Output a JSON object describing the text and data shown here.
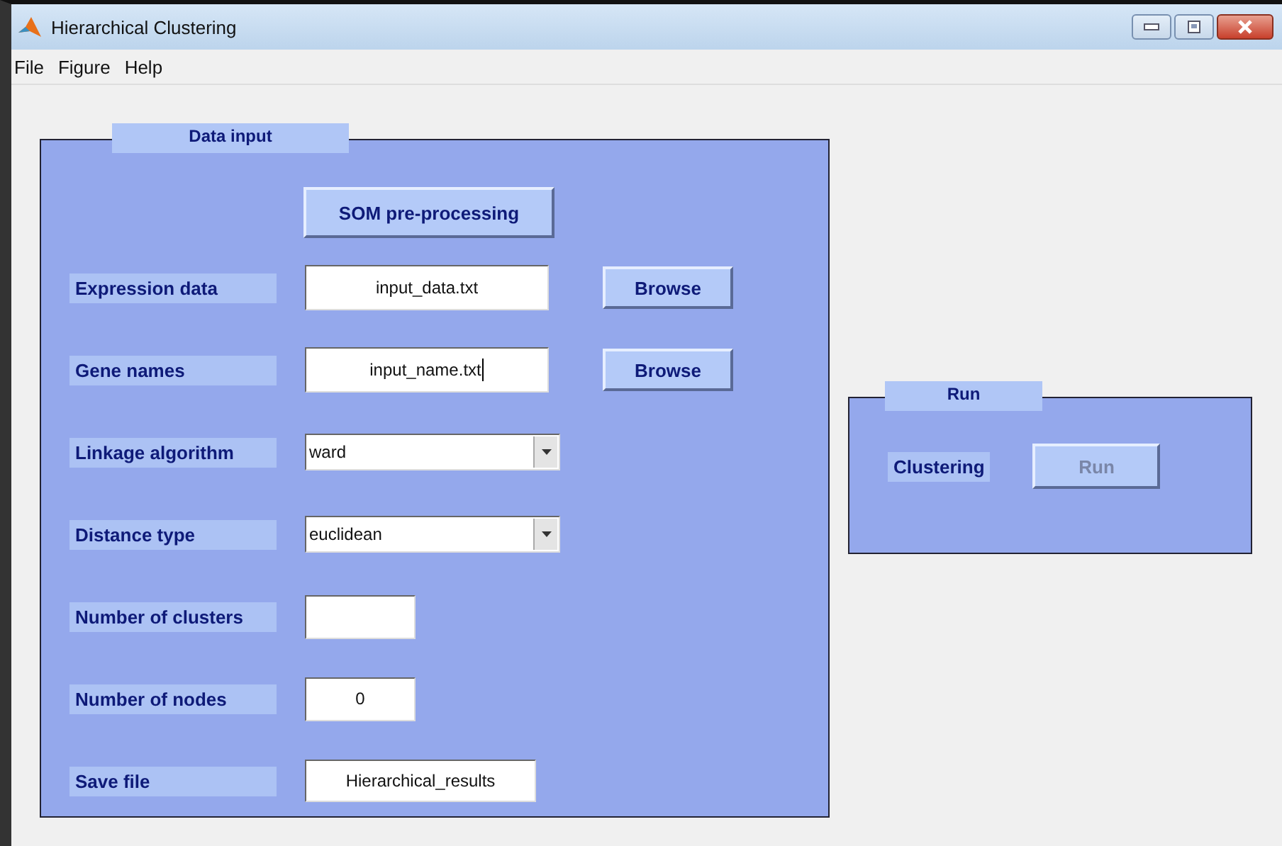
{
  "window": {
    "title": "Hierarchical Clustering"
  },
  "menu": [
    "File",
    "Figure",
    "Help"
  ],
  "data_input": {
    "title": "Data input",
    "som_button": "SOM pre-processing",
    "rows": [
      {
        "kind": "file",
        "label": "Expression data",
        "value": "input_data.txt",
        "button": "Browse",
        "focused": false
      },
      {
        "kind": "file",
        "label": "Gene names",
        "value": "input_name.txt",
        "button": "Browse",
        "focused": true
      },
      {
        "kind": "dropdown",
        "label": "Linkage algorithm",
        "value": "ward"
      },
      {
        "kind": "dropdown",
        "label": "Distance type",
        "value": "euclidean"
      },
      {
        "kind": "short",
        "label": "Number of clusters"
      },
      {
        "kind": "short",
        "label": "Number of nodes",
        "value": "0"
      },
      {
        "kind": "medium",
        "label": "Save file",
        "value": "Hierarchical_results"
      }
    ]
  },
  "run_panel": {
    "title": "Run",
    "label": "Clustering",
    "button": {
      "label": "Run",
      "disabled": true
    }
  }
}
